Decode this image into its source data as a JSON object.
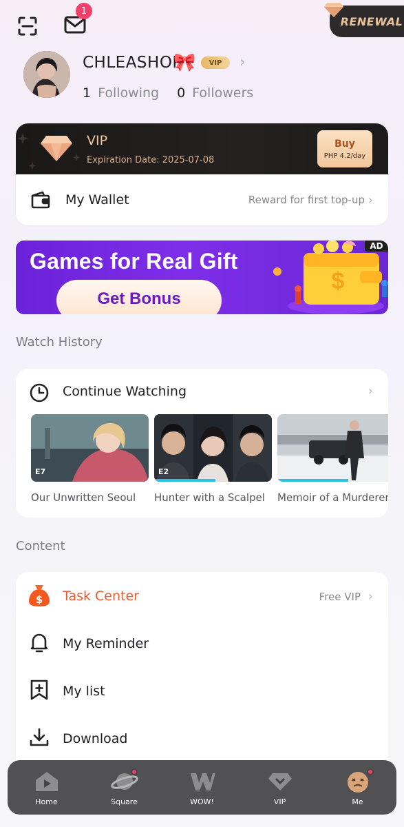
{
  "header": {
    "mail_badge": "1",
    "renewal_label": "RENEWAL"
  },
  "profile": {
    "username": "CHLEASHOP",
    "username_emoji": "🎀",
    "vip_badge": "VIP",
    "following_count": "1",
    "following_label": "Following",
    "followers_count": "0",
    "followers_label": "Followers"
  },
  "vip": {
    "title": "VIP",
    "expiration": "Expiration Date: 2025-07-08",
    "buy_label": "Buy",
    "buy_price": "PHP 4.2/day"
  },
  "wallet": {
    "label": "My Wallet",
    "subtitle": "Reward for first top-up"
  },
  "banner": {
    "title": "Games for Real Gift",
    "button_label": "Get Bonus",
    "ad_tag": "AD"
  },
  "watch_history": {
    "section_title": "Watch History",
    "continue_label": "Continue Watching",
    "items": [
      {
        "title": "Our Unwritten Seoul",
        "episode": "E7",
        "progress": 0
      },
      {
        "title": "Hunter with a Scalpel",
        "episode": "E2",
        "progress": 0.52
      },
      {
        "title": "Memoir of a Murderer",
        "episode": "",
        "progress": 0.6
      }
    ]
  },
  "content": {
    "section_title": "Content",
    "items": [
      {
        "label": "Task Center",
        "subtitle": "Free VIP",
        "icon": "money-bag-icon",
        "color": "#f05a2a"
      },
      {
        "label": "My Reminder",
        "subtitle": "",
        "icon": "bell-icon"
      },
      {
        "label": "My list",
        "subtitle": "",
        "icon": "bookmark-plus-icon"
      },
      {
        "label": "Download",
        "subtitle": "",
        "icon": "download-icon"
      }
    ]
  },
  "tabbar": {
    "tabs": [
      {
        "label": "Home",
        "icon": "play-home-icon"
      },
      {
        "label": "Square",
        "icon": "planet-icon",
        "dot": true
      },
      {
        "label": "WOW!",
        "icon": "w-logo-icon"
      },
      {
        "label": "VIP",
        "icon": "vip-diamond-icon"
      },
      {
        "label": "Me",
        "icon": "face-icon",
        "dot": true
      }
    ]
  }
}
